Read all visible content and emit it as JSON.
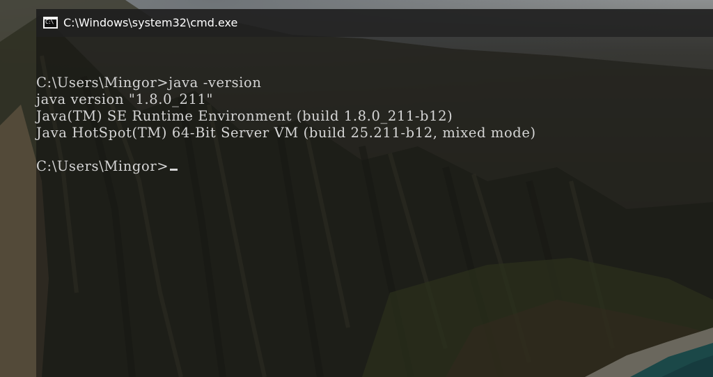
{
  "window": {
    "title": "C:\\Windows\\system32\\cmd.exe",
    "icon_glyph": "C:\\"
  },
  "terminal": {
    "lines": [
      "",
      "C:\\Users\\Mingor>java -version",
      "java version \"1.8.0_211\"",
      "Java(TM) SE Runtime Environment (build 1.8.0_211-b12)",
      "Java HotSpot(TM) 64-Bit Server VM (build 25.211-b12, mixed mode)",
      "",
      "C:\\Users\\Mingor>"
    ]
  },
  "colors": {
    "console_text": "#d6d6d6",
    "titlebar_text": "#ffffff"
  }
}
